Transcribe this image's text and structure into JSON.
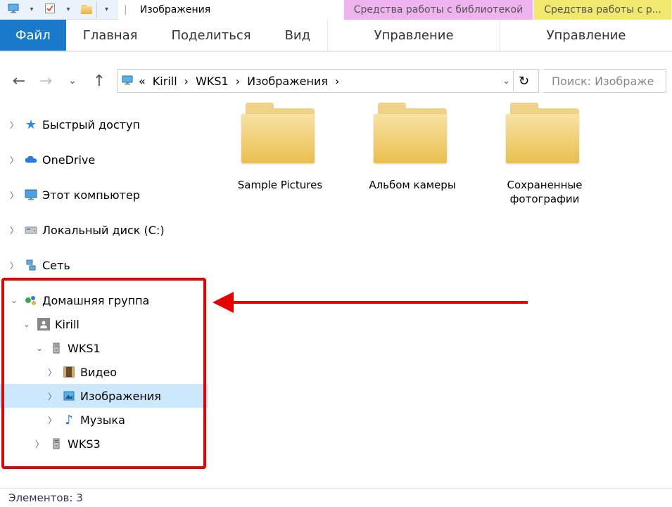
{
  "window_title": "Изображения",
  "context_tabs": {
    "library": "Средства работы с библиотекой",
    "pictures": "Средства работы с р..."
  },
  "ribbon": {
    "file": "Файл",
    "home": "Главная",
    "share": "Поделиться",
    "view": "Вид",
    "manage1": "Управление",
    "manage2": "Управление"
  },
  "breadcrumb": {
    "sep_first": "«",
    "p1": "Kirill",
    "p2": "WKS1",
    "p3": "Изображения"
  },
  "search_placeholder": "Поиск: Изображе",
  "tree": {
    "quick_access": "Быстрый доступ",
    "onedrive": "OneDrive",
    "this_pc": "Этот компьютер",
    "local_disk": "Локальный диск (C:)",
    "network": "Сеть",
    "homegroup": "Домашняя группа",
    "user": "Kirill",
    "wks1": "WKS1",
    "video": "Видео",
    "images": "Изображения",
    "music": "Музыка",
    "wks3": "WKS3"
  },
  "folders": [
    {
      "name": "Sample Pictures"
    },
    {
      "name": "Альбом камеры"
    },
    {
      "name": "Сохраненные фотографии"
    }
  ],
  "status_count_label": "Элементов:",
  "status_count": "3"
}
